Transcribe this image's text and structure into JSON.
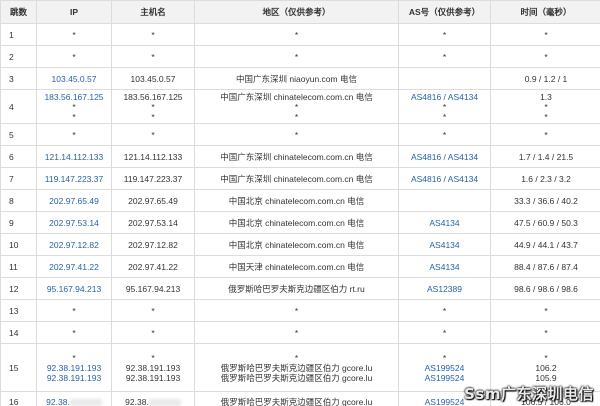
{
  "headers": {
    "hop": "跳数",
    "ip": "IP",
    "host": "主机名",
    "region": "地区（仅供参考）",
    "as": "AS号（仅供参考）",
    "time": "时间（毫秒）"
  },
  "rows": [
    {
      "hop": "1",
      "ip": [
        "*"
      ],
      "host": [
        "*"
      ],
      "region": [
        "*"
      ],
      "as": [
        "*"
      ],
      "time": [
        "*"
      ],
      "kind": "normal"
    },
    {
      "hop": "2",
      "ip": [
        "*"
      ],
      "host": [
        "*"
      ],
      "region": [
        "*"
      ],
      "as": [
        "*"
      ],
      "time": [
        "*"
      ],
      "kind": "normal"
    },
    {
      "hop": "3",
      "ip": [
        "103.45.0.57"
      ],
      "host": [
        "103.45.0.57"
      ],
      "region": [
        "中国广东深圳 niaoyun.com 电信"
      ],
      "as": [
        ""
      ],
      "time": [
        "0.9 / 1.2 / 1"
      ],
      "kind": "normal"
    },
    {
      "hop": "4",
      "ip": [
        "183.56.167.125",
        "*",
        "*"
      ],
      "host": [
        "183.56.167.125",
        "*",
        "*"
      ],
      "region": [
        "中国广东深圳 chinatelecom.com.cn 电信",
        "*",
        "*"
      ],
      "as": [
        "AS4816 / AS4134",
        "*",
        "*"
      ],
      "time": [
        "1.3",
        "*",
        "*"
      ],
      "kind": "tall"
    },
    {
      "hop": "5",
      "ip": [
        "*"
      ],
      "host": [
        "*"
      ],
      "region": [
        "*"
      ],
      "as": [
        "*"
      ],
      "time": [
        "*"
      ],
      "kind": "normal"
    },
    {
      "hop": "6",
      "ip": [
        "121.14.112.133"
      ],
      "host": [
        "121.14.112.133"
      ],
      "region": [
        "中国广东深圳 chinatelecom.com.cn 电信"
      ],
      "as": [
        "AS4816 / AS4134"
      ],
      "time": [
        "1.7 / 1.4 / 21.5"
      ],
      "kind": "normal"
    },
    {
      "hop": "7",
      "ip": [
        "119.147.223.37"
      ],
      "host": [
        "119.147.223.37"
      ],
      "region": [
        "中国广东深圳 chinatelecom.com.cn 电信"
      ],
      "as": [
        "AS4816 / AS4134"
      ],
      "time": [
        "1.6 / 2.3 / 3.2"
      ],
      "kind": "normal"
    },
    {
      "hop": "8",
      "ip": [
        "202.97.65.49"
      ],
      "host": [
        "202.97.65.49"
      ],
      "region": [
        "中国北京 chinatelecom.com.cn 电信"
      ],
      "as": [
        ""
      ],
      "time": [
        "33.3 / 36.6 / 40.2"
      ],
      "kind": "normal"
    },
    {
      "hop": "9",
      "ip": [
        "202.97.53.14"
      ],
      "host": [
        "202.97.53.14"
      ],
      "region": [
        "中国北京 chinatelecom.com.cn 电信"
      ],
      "as": [
        "AS4134"
      ],
      "time": [
        "47.5 / 60.9 / 50.3"
      ],
      "kind": "normal"
    },
    {
      "hop": "10",
      "ip": [
        "202.97.12.82"
      ],
      "host": [
        "202.97.12.82"
      ],
      "region": [
        "中国北京 chinatelecom.com.cn 电信"
      ],
      "as": [
        "AS4134"
      ],
      "time": [
        "44.9 / 44.1 / 43.7"
      ],
      "kind": "normal"
    },
    {
      "hop": "11",
      "ip": [
        "202.97.41.22"
      ],
      "host": [
        "202.97.41.22"
      ],
      "region": [
        "中国天津 chinatelecom.com.cn 电信"
      ],
      "as": [
        "AS4134"
      ],
      "time": [
        "88.4 / 87.6 / 87.4"
      ],
      "kind": "normal"
    },
    {
      "hop": "12",
      "ip": [
        "95.167.94.213"
      ],
      "host": [
        "95.167.94.213"
      ],
      "region": [
        "俄罗斯哈巴罗夫斯克边疆区伯力 rt.ru"
      ],
      "as": [
        "AS12389"
      ],
      "time": [
        "98.6 / 98.6 / 98.6"
      ],
      "kind": "normal"
    },
    {
      "hop": "13",
      "ip": [
        "*"
      ],
      "host": [
        "*"
      ],
      "region": [
        "*"
      ],
      "as": [
        "*"
      ],
      "time": [
        "*"
      ],
      "kind": "normal"
    },
    {
      "hop": "14",
      "ip": [
        "*"
      ],
      "host": [
        "*"
      ],
      "region": [
        "*"
      ],
      "as": [
        "*"
      ],
      "time": [
        "*"
      ],
      "kind": "normal"
    },
    {
      "hop": "15",
      "ip": [
        "*",
        "92.38.191.193",
        "92.38.191.193"
      ],
      "host": [
        "*",
        "92.38.191.193",
        "92.38.191.193"
      ],
      "region": [
        "*",
        "俄罗斯哈巴罗夫斯克边疆区伯力 gcore.lu",
        "俄罗斯哈巴罗夫斯克边疆区伯力 gcore.lu"
      ],
      "as": [
        "*",
        "AS199524",
        "AS199524"
      ],
      "time": [
        "*",
        "106.2",
        "105.9"
      ],
      "kind": "tall2"
    },
    {
      "hop": "16",
      "ip": [
        "92.38."
      ],
      "host": [
        "92.38."
      ],
      "region": [
        "俄罗斯哈巴罗夫斯克边疆区伯力 gcore.lu"
      ],
      "as": [
        "AS199524"
      ],
      "time": [
        "106.5 / 106.0"
      ],
      "kind": "last",
      "redacted": true
    }
  ],
  "watermark": "Ssm广东深圳电信",
  "colors": {
    "link": "#2563a8",
    "header_bg": "#f2f2f2",
    "border": "#dcdcdc"
  }
}
